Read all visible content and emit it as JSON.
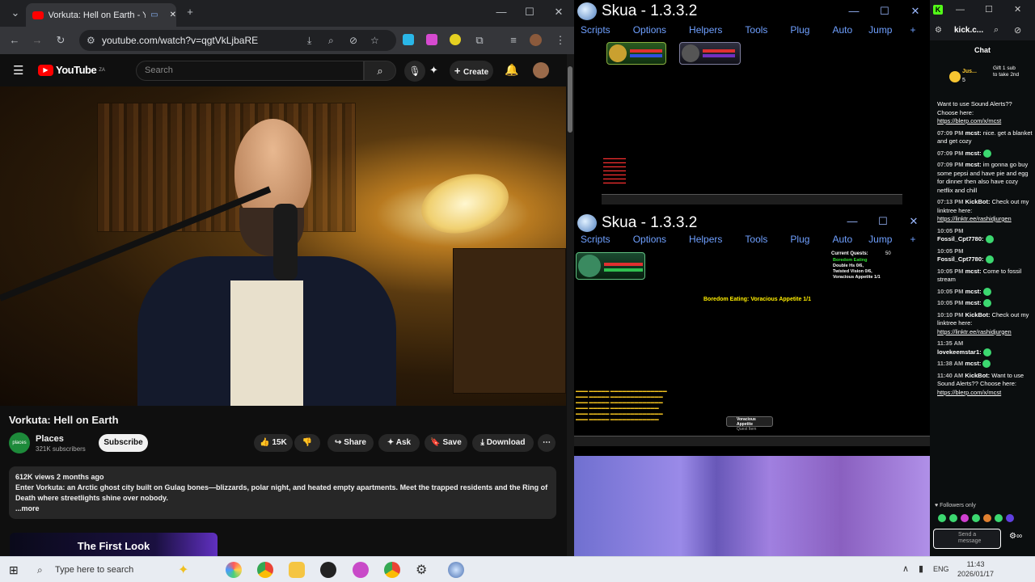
{
  "chrome": {
    "tab_title": "Vorkuta: Hell on Earth - You",
    "url": "youtube.com/watch?v=qgtVkLjbaRE",
    "controls": {
      "minimize": "—",
      "maximize": "☐",
      "close": "✕"
    }
  },
  "youtube": {
    "logo": "YouTube",
    "logo_sup": "ZA",
    "search_placeholder": "Search",
    "create_label": "Create",
    "video_title": "Vorkuta: Hell on Earth",
    "channel_name": "Places",
    "channel_avatar_text": "places",
    "subscribers": "321K subscribers",
    "subscribe_label": "Subscribe",
    "likes": "15K",
    "share_label": "Share",
    "ask_label": "Ask",
    "save_label": "Save",
    "download_label": "Download",
    "views_date": "612K views  2 months ago",
    "description": "Enter Vorkuta: an Arctic ghost city built on Gulag bones—blizzards, polar night, and heated empty apartments. Meet the trapped residents and the Ring of Death where streetlights shine over nobody.",
    "more_label": "...more",
    "thumb_text": "The First Look"
  },
  "skua_top": {
    "title": "Skua - 1.3.3.2",
    "menu": [
      "Scripts",
      "Options",
      "Helpers",
      "Tools",
      "Plug",
      "Auto",
      "Jump",
      "+"
    ]
  },
  "skua_bottom": {
    "title": "Skua - 1.3.3.2",
    "menu": [
      "Scripts",
      "Options",
      "Helpers",
      "Tools",
      "Plug",
      "Auto",
      "Jump",
      "+"
    ],
    "quest_header": "Current Quests:",
    "quests": [
      "Boredom Eating",
      "Double Hs 0/6,",
      "Twisted Vision 0/6,",
      "Voracious Appetite 1/1"
    ],
    "quest_count": "50",
    "center_message": "Boredom Eating: Voracious Appetite 1/1",
    "popup_title": "Voracious Appetite",
    "popup_sub": "Quest Item"
  },
  "kick": {
    "tab": "kick.c...",
    "header": "Chat",
    "pinned_user": "Jus...",
    "pinned_count": "5",
    "pinned_text": "Gift 1 sub to take 2nd",
    "messages": [
      {
        "time": "",
        "user": "",
        "text": "Want to use Sound Alerts?? Choose here:",
        "link": "https://blerp.com/x/mcst"
      },
      {
        "time": "07:09 PM",
        "user": "mcst:",
        "text": "nice. get a blanket and get cozy",
        "link": ""
      },
      {
        "time": "07:09 PM",
        "user": "mcst:",
        "text": "",
        "link": ""
      },
      {
        "time": "07:09 PM",
        "user": "mcst:",
        "text": "im gonna go buy some pepsi and have pie and egg for dinner then also have cozy netflix and chill",
        "link": ""
      },
      {
        "time": "07:13 PM",
        "user": "KickBot:",
        "text": "Check out my linktree here:",
        "link": "https://linktr.ee/rashidjurgen"
      },
      {
        "time": "10:05 PM",
        "user": "Fossil_Cpt7780:",
        "text": "",
        "link": ""
      },
      {
        "time": "10:05 PM",
        "user": "Fossil_Cpt7780:",
        "text": "",
        "link": ""
      },
      {
        "time": "10:05 PM",
        "user": "mcst:",
        "text": "Come to fossil stream",
        "link": ""
      },
      {
        "time": "10:05 PM",
        "user": "mcst:",
        "text": "",
        "link": ""
      },
      {
        "time": "10:05 PM",
        "user": "mcst:",
        "text": "",
        "link": ""
      },
      {
        "time": "10:10 PM",
        "user": "KickBot:",
        "text": "Check out my linktree here:",
        "link": "https://linktr.ee/rashidjurgen"
      },
      {
        "time": "11:35 AM",
        "user": "lovekeemstar1:",
        "text": "",
        "link": ""
      },
      {
        "time": "11:38 AM",
        "user": "mcst:",
        "text": "",
        "link": ""
      },
      {
        "time": "11:40 AM",
        "user": "KickBot:",
        "text": "Want to use Sound Alerts?? Choose here:",
        "link": "https://blerp.com/x/mcst"
      }
    ],
    "followers_only": "Followers only",
    "send_placeholder": "Send a message"
  },
  "taskbar": {
    "search_placeholder": "Type here to search",
    "lang": "ENG",
    "time": "11:43",
    "date": "2026/01/17"
  }
}
